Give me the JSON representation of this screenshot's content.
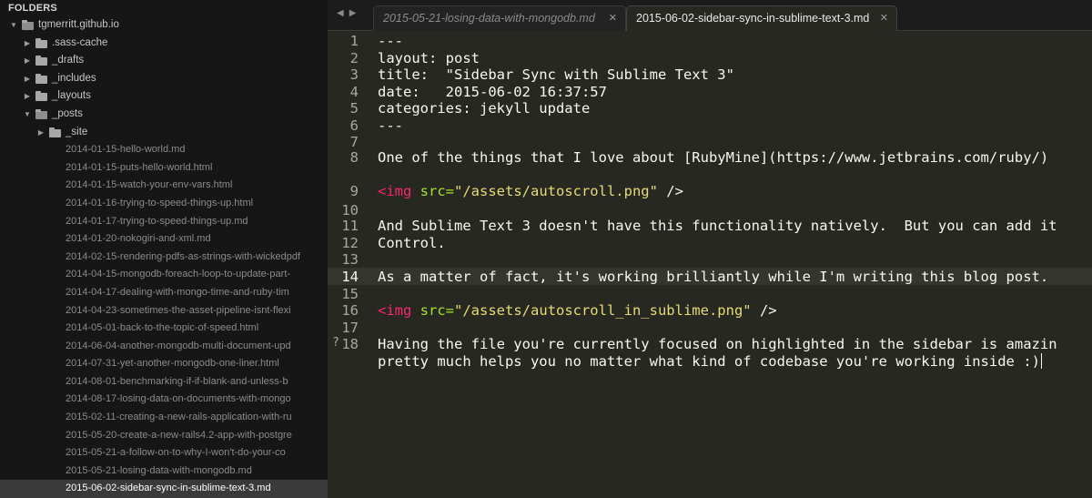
{
  "sidebar": {
    "title": "FOLDERS",
    "root": "tgmerritt.github.io",
    "folders": [
      {
        "label": ".sass-cache"
      },
      {
        "label": "_drafts"
      },
      {
        "label": "_includes"
      },
      {
        "label": "_layouts"
      },
      {
        "label": "_posts"
      }
    ],
    "subfolder": "_site",
    "files": [
      "2014-01-15-hello-world.md",
      "2014-01-15-puts-hello-world.html",
      "2014-01-15-watch-your-env-vars.html",
      "2014-01-16-trying-to-speed-things-up.html",
      "2014-01-17-trying-to-speed-things-up.md",
      "2014-01-20-nokogiri-and-xml.md",
      "2014-02-15-rendering-pdfs-as-strings-with-wickedpdf",
      "2014-04-15-mongodb-foreach-loop-to-update-part-",
      "2014-04-17-dealing-with-mongo-time-and-ruby-tim",
      "2014-04-23-sometimes-the-asset-pipeline-isnt-flexi",
      "2014-05-01-back-to-the-topic-of-speed.html",
      "2014-06-04-another-mongodb-multi-document-upd",
      "2014-07-31-yet-another-mongodb-one-liner.html",
      "2014-08-01-benchmarking-if-if-blank-and-unless-b",
      "2014-08-17-losing-data-on-documents-with-mongo",
      "2015-02-11-creating-a-new-rails-application-with-ru",
      "2015-05-20-create-a-new-rails4.2-app-with-postgre",
      "2015-05-21-a-follow-on-to-why-I-won't-do-your-co",
      "2015-05-21-losing-data-with-mongodb.md",
      "2015-06-02-sidebar-sync-in-sublime-text-3.md"
    ],
    "selected_index": 19
  },
  "tabs": [
    {
      "label": "2015-05-21-losing-data-with-mongodb.md",
      "active": false
    },
    {
      "label": "2015-06-02-sidebar-sync-in-sublime-text-3.md",
      "active": true
    }
  ],
  "nav": {
    "back": "◀",
    "forward": "▶"
  },
  "editor": {
    "current_line": "14",
    "line_numbers": [
      "1",
      "2",
      "3",
      "4",
      "5",
      "6",
      "7",
      "8",
      "9",
      "10",
      "11",
      "12",
      "13",
      "14",
      "15",
      "16",
      "17",
      "18"
    ],
    "lines": {
      "l1": "---",
      "l2": "layout: post",
      "l3": "title:  \"Sidebar Sync with Sublime Text 3\"",
      "l4": "date:   2015-06-02 16:37:57",
      "l5": "categories: jekyll update",
      "l6": "---",
      "l8": "One of the things that I love about [RubyMine](https://www.jetbrains.com/ruby/)",
      "l10_tag": "<img",
      "l10_attr": " src=",
      "l10_str": "\"/assets/autoscroll.png\"",
      "l10_end": " />",
      "l12a": "And Sublime Text 3 doesn't have this functionality natively.  But you can add it",
      "l12b": "Control.",
      "l14": "As a matter of fact, it's working brilliantly while I'm writing this blog post.",
      "l16_tag": "<img",
      "l16_attr": " src=",
      "l16_str": "\"/assets/autoscroll_in_sublime.png\"",
      "l16_end": " />",
      "l18a": "Having the file you're currently focused on highlighted in the sidebar is amazin",
      "l18b": "pretty much helps you no matter what kind of codebase you're working inside :",
      "l18_caret_char": ")"
    },
    "marker": "?"
  },
  "colors": {
    "background": "#272822",
    "sidebar": "#161616",
    "tag": "#f92672",
    "attribute": "#a6e22e",
    "string": "#e6db74"
  }
}
